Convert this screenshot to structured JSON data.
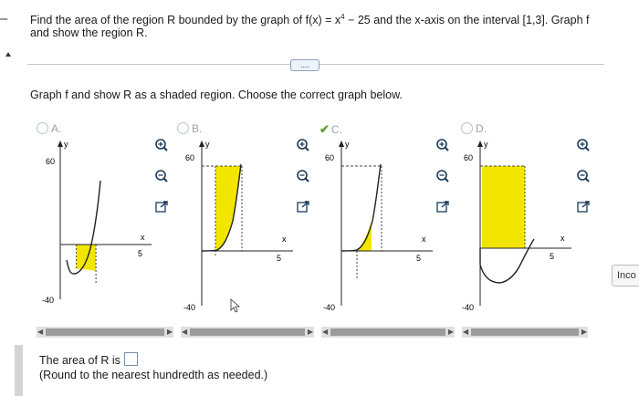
{
  "question": {
    "part1": "Find the area of the region R bounded by the graph of f(x) = x",
    "exp": "4",
    "part2": " − 25 and the x-axis on the interval [1,3]. Graph f and show the region R."
  },
  "more_button": "....",
  "prompt": "Graph f and show R as a shaded region. Choose the correct graph below.",
  "options": [
    {
      "label": "A.",
      "selected": false
    },
    {
      "label": "B.",
      "selected": false
    },
    {
      "label": "C.",
      "selected": true
    },
    {
      "label": "D.",
      "selected": false
    }
  ],
  "graph_labels": {
    "y": "y",
    "x": "x",
    "ytop": "60",
    "ybottom": "-40",
    "xtick": "5"
  },
  "answer": {
    "label": "The area of R is",
    "hint": "(Round to the nearest hundredth as needed.)"
  },
  "side_text": "Inco",
  "icons": [
    "zoom-in-icon",
    "zoom-out-icon",
    "external-link-icon"
  ],
  "colors": {
    "shade": "#f2e600",
    "curve": "#222222",
    "accent_check": "#5aa02c"
  }
}
